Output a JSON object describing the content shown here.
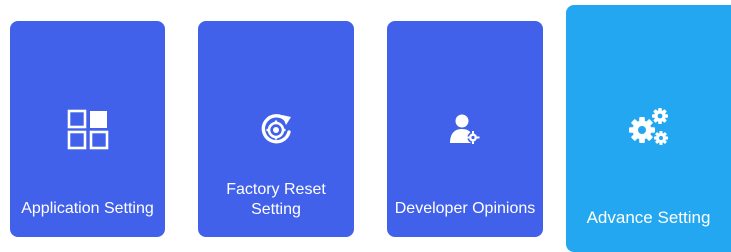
{
  "tiles": [
    {
      "label": "Application Setting",
      "icon": "grid-apps-icon",
      "color": "#4161ea",
      "selected": false
    },
    {
      "label": "Factory Reset\nSetting",
      "icon": "factory-reset-icon",
      "color": "#4161ea",
      "selected": false
    },
    {
      "label": "Developer Opinions",
      "icon": "developer-person-gear-icon",
      "color": "#4161ea",
      "selected": false
    },
    {
      "label": "Advance Setting",
      "icon": "gears-icon",
      "color": "#22a7f0",
      "selected": true
    }
  ]
}
